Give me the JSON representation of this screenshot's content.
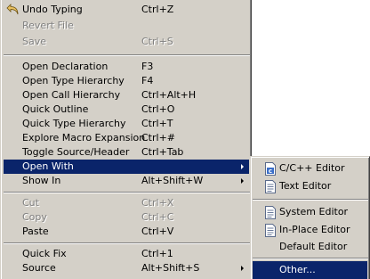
{
  "menu": {
    "items": [
      {
        "label": "Undo Typing",
        "accel": "Ctrl+Z",
        "icon": "undo-icon"
      },
      {
        "label": "Revert File",
        "accel": ""
      },
      {
        "label": "Save",
        "accel": "Ctrl+S"
      },
      {
        "label": "Open Declaration",
        "accel": "F3"
      },
      {
        "label": "Open Type Hierarchy",
        "accel": "F4"
      },
      {
        "label": "Open Call Hierarchy",
        "accel": "Ctrl+Alt+H"
      },
      {
        "label": "Quick Outline",
        "accel": "Ctrl+O"
      },
      {
        "label": "Quick Type Hierarchy",
        "accel": "Ctrl+T"
      },
      {
        "label": "Explore Macro Expansion",
        "accel": "Ctrl+#"
      },
      {
        "label": "Toggle Source/Header",
        "accel": "Ctrl+Tab"
      },
      {
        "label": "Open With",
        "accel": ""
      },
      {
        "label": "Show In",
        "accel": "Alt+Shift+W"
      },
      {
        "label": "Cut",
        "accel": "Ctrl+X"
      },
      {
        "label": "Copy",
        "accel": "Ctrl+C"
      },
      {
        "label": "Paste",
        "accel": "Ctrl+V"
      },
      {
        "label": "Quick Fix",
        "accel": "Ctrl+1"
      },
      {
        "label": "Source",
        "accel": "Alt+Shift+S"
      }
    ]
  },
  "submenu": {
    "items": [
      {
        "label": "C/C++ Editor",
        "icon": "c-file-icon"
      },
      {
        "label": "Text Editor",
        "icon": "text-file-icon"
      },
      {
        "label": "System Editor",
        "icon": "text-file-icon"
      },
      {
        "label": "In-Place Editor",
        "icon": "text-file-icon"
      },
      {
        "label": "Default Editor"
      },
      {
        "label": "Other..."
      }
    ]
  },
  "colors": {
    "menu_bg": "#d4d0c8",
    "highlight": "#0a246a",
    "disabled_text": "#808080"
  }
}
